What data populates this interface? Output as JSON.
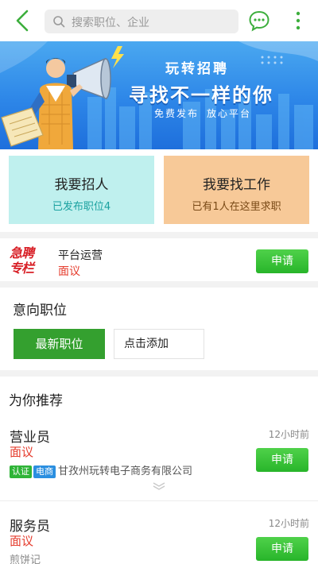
{
  "search": {
    "placeholder": "搜索职位、企业"
  },
  "banner": {
    "brand": "玩转招聘",
    "headline": "寻找不一样的你",
    "tagline_1": "免费发布",
    "tagline_2": "放心平台"
  },
  "cards": {
    "hire": {
      "title": "我要招人",
      "subtitle": "已发布职位4"
    },
    "find_job": {
      "title": "我要找工作",
      "subtitle": "已有1人在这里求职"
    }
  },
  "urgent": {
    "logo_line1": "急聘",
    "logo_line2": "专栏",
    "job_name": "平台运营",
    "salary": "面议",
    "apply_label": "申请"
  },
  "intent": {
    "heading": "意向职位",
    "latest_label": "最新职位",
    "add_label": "点击添加"
  },
  "recommend": {
    "heading": "为你推荐",
    "items": [
      {
        "title": "营业员",
        "salary": "面议",
        "time": "12小时前",
        "tag1": "认证",
        "tag2": "电商",
        "company": "甘孜州玩转电子商务有限公司",
        "apply_label": "申请"
      },
      {
        "title": "服务员",
        "salary": "面议",
        "time": "12小时前",
        "company": "煎饼记",
        "apply_label": "申请"
      }
    ]
  },
  "colors": {
    "accent_green": "#34a02f",
    "salary_red": "#e53c2d",
    "urgent_red": "#d81f26"
  }
}
